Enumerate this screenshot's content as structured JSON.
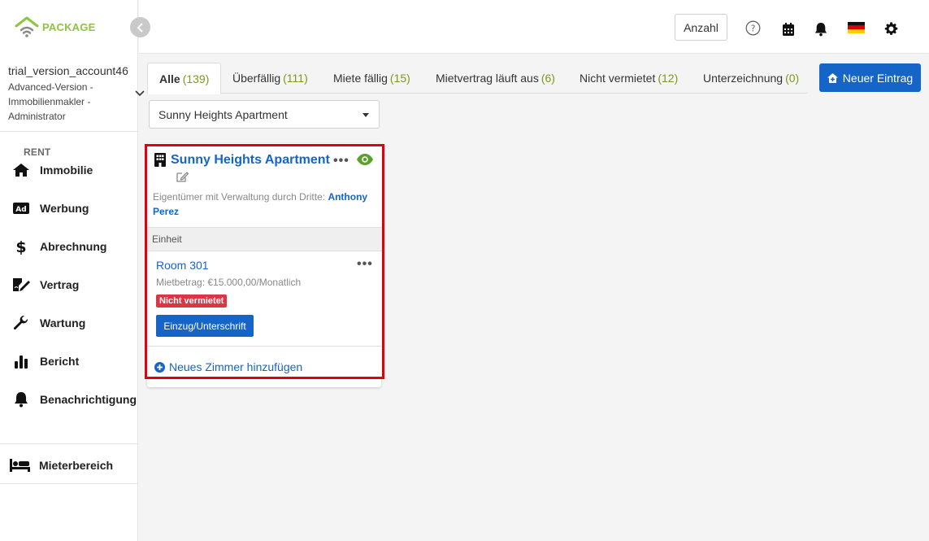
{
  "brand": {
    "part1": "RENT",
    "part2": "PACKAGE"
  },
  "account": {
    "name": "trial_version_account46",
    "role": "Advanced-Version - Immobilienmakler - Administrator"
  },
  "sidebar": {
    "items": [
      {
        "label": "Immobilie",
        "icon": "home-icon"
      },
      {
        "label": "Werbung",
        "icon": "ad-icon"
      },
      {
        "label": "Abrechnung",
        "icon": "dollar-icon"
      },
      {
        "label": "Vertrag",
        "icon": "contract-icon"
      },
      {
        "label": "Wartung",
        "icon": "wrench-icon"
      },
      {
        "label": "Bericht",
        "icon": "bar-chart-icon"
      },
      {
        "label": "Benachrichtigung",
        "icon": "bell-icon"
      }
    ],
    "tenant": {
      "label": "Mieterbereich",
      "icon": "bed-icon"
    }
  },
  "topbar": {
    "count_label": "Anzahl"
  },
  "tabs": [
    {
      "label": "Alle",
      "count": "(139)"
    },
    {
      "label": "Überfällig",
      "count": "(111)"
    },
    {
      "label": "Miete fällig",
      "count": "(15)"
    },
    {
      "label": "Mietvertrag läuft aus",
      "count": "(6)"
    },
    {
      "label": "Nicht vermietet",
      "count": "(12)"
    },
    {
      "label": "Unterzeichnung",
      "count": "(0)"
    }
  ],
  "new_entry_label": "Neuer Eintrag",
  "property_select": {
    "selected": "Sunny Heights Apartment"
  },
  "card": {
    "title": "Sunny Heights Apartment",
    "owner_label": "Eigentümer mit Verwaltung durch Dritte:",
    "owner_name": "Anthony Perez",
    "unit_header": "Einheit",
    "room": {
      "name": "Room 301",
      "rent": "Mietbetrag: €15.000,00/Monatlich",
      "status": "Nicht vermietet",
      "action": "Einzug/Unterschrift"
    },
    "add_room_label": "Neues Zimmer hinzufügen"
  },
  "colors": {
    "primary": "#1565c8",
    "accent": "#8cc63f",
    "danger": "#dc3545",
    "highlight": "#e0000f"
  }
}
